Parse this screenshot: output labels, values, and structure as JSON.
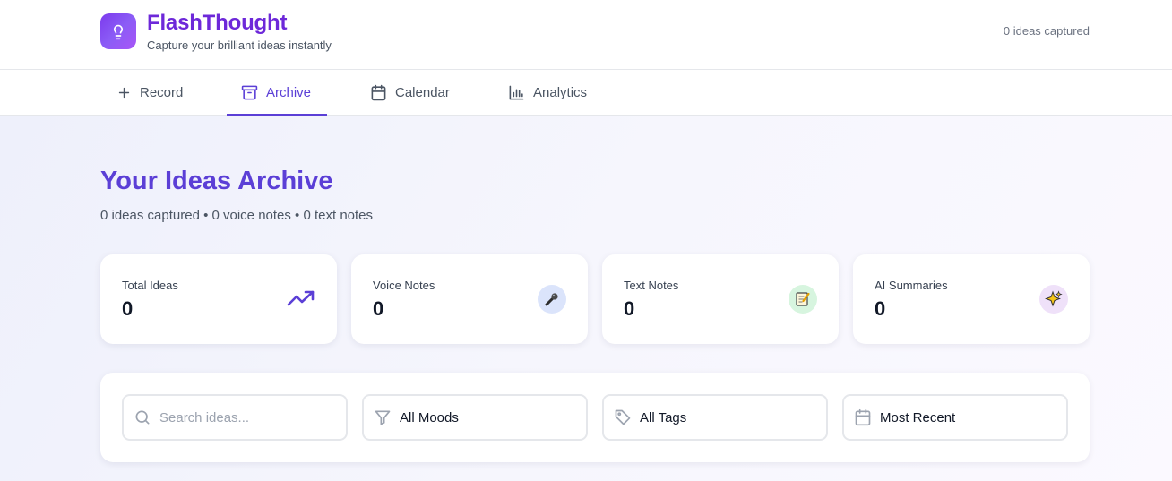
{
  "app": {
    "title": "FlashThought",
    "subtitle": "Capture your brilliant ideas instantly",
    "header_count": "0 ideas captured",
    "accent": "#5b3fd6",
    "logo_icon": "lightbulb-icon"
  },
  "nav": {
    "tabs": [
      {
        "label": "Record",
        "icon": "plus-icon",
        "active": false
      },
      {
        "label": "Archive",
        "icon": "archive-icon",
        "active": true
      },
      {
        "label": "Calendar",
        "icon": "calendar-icon",
        "active": false
      },
      {
        "label": "Analytics",
        "icon": "bar-chart-icon",
        "active": false
      }
    ]
  },
  "archive": {
    "title": "Your Ideas Archive",
    "summary": "0 ideas captured • 0 voice notes • 0 text notes"
  },
  "stats": [
    {
      "label": "Total Ideas",
      "value": "0",
      "icon": "trending-up-icon"
    },
    {
      "label": "Voice Notes",
      "value": "0",
      "icon": "microphone-icon"
    },
    {
      "label": "Text Notes",
      "value": "0",
      "icon": "memo-icon"
    },
    {
      "label": "AI Summaries",
      "value": "0",
      "icon": "sparkles-icon"
    }
  ],
  "filters": {
    "search_placeholder": "Search ideas...",
    "mood": "All Moods",
    "tags": "All Tags",
    "sort": "Most Recent"
  }
}
